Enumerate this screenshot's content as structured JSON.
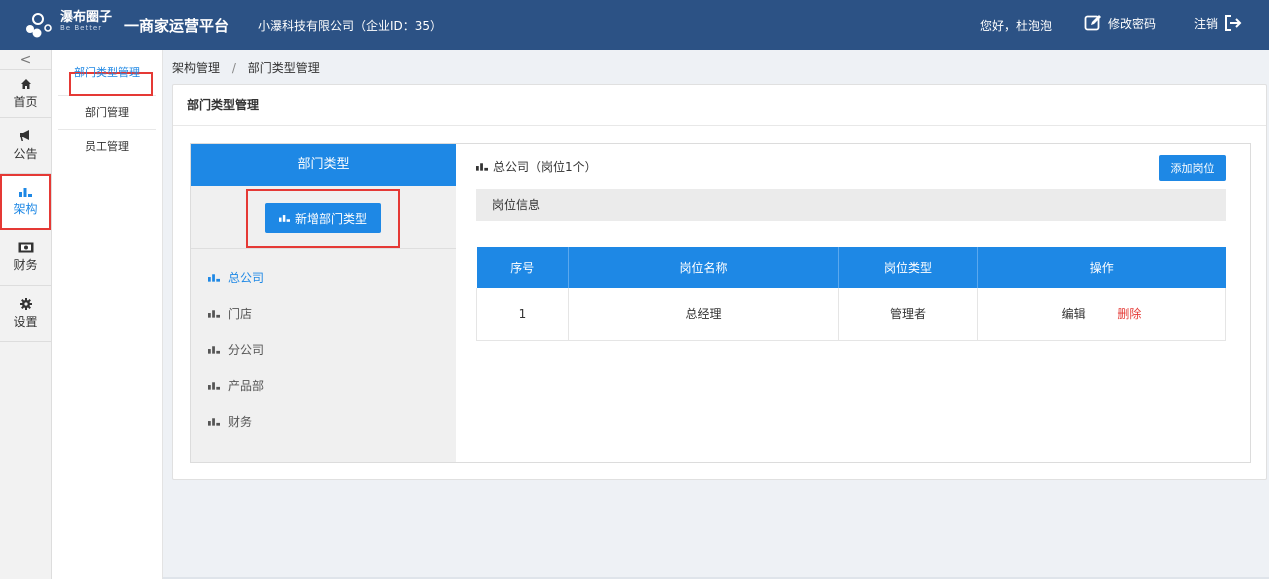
{
  "header": {
    "brand_cn": "瀑布圈子",
    "brand_en": "Be Better",
    "platform": "一商家运营平台",
    "company": "小瀑科技有限公司（企业ID：35）",
    "greeting": "您好，杜泡泡",
    "change_password": "修改密码",
    "logout": "注销"
  },
  "rail": {
    "collapse": "<",
    "items": [
      {
        "label": "首页",
        "icon": "home-icon"
      },
      {
        "label": "公告",
        "icon": "megaphone-icon"
      },
      {
        "label": "架构",
        "icon": "bar-chart-icon"
      },
      {
        "label": "财务",
        "icon": "money-icon"
      },
      {
        "label": "设置",
        "icon": "gear-icon"
      }
    ],
    "active": "架构"
  },
  "submenu": {
    "items": [
      "部门类型管理",
      "部门管理",
      "员工管理"
    ],
    "active": "部门类型管理"
  },
  "breadcrumb": {
    "parent": "架构管理",
    "separator": "/",
    "current": "部门类型管理"
  },
  "panel": {
    "title": "部门类型管理"
  },
  "dept": {
    "header": "部门类型",
    "add_button": "新增部门类型",
    "items": [
      "总公司",
      "门店",
      "分公司",
      "产品部",
      "财务"
    ],
    "active": "总公司"
  },
  "positions": {
    "title": "总公司（岗位1个）",
    "add_button": "添加岗位",
    "info_label": "岗位信息",
    "columns": [
      "序号",
      "岗位名称",
      "岗位类型",
      "操作"
    ],
    "rows": [
      {
        "index": "1",
        "name": "总经理",
        "type": "管理者",
        "edit": "编辑",
        "delete": "删除"
      }
    ]
  },
  "colors": {
    "header_bg": "#2c5285",
    "accent": "#1e88e5",
    "danger": "#e53935"
  }
}
